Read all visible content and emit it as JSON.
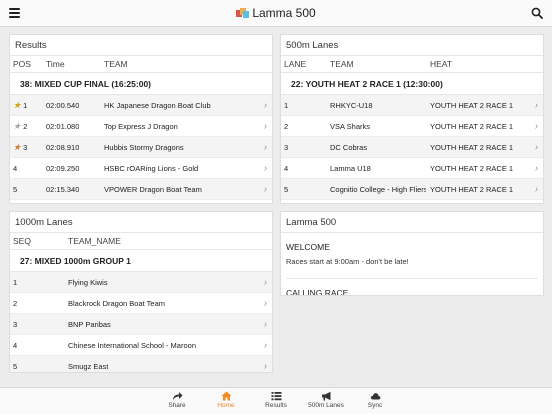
{
  "header": {
    "title": "Lamma 500"
  },
  "results": {
    "title": "Results",
    "columns": {
      "pos": "POS",
      "time": "Time",
      "team": "TEAM"
    },
    "group": "38: MIXED CUP FINAL (16:25:00)",
    "rows": [
      {
        "pos": "1",
        "time": "02:00.540",
        "team": "HK Japanese Dragon Boat Club",
        "medal": "gold"
      },
      {
        "pos": "2",
        "time": "02:01.080",
        "team": "Top Express J Dragon",
        "medal": "silver"
      },
      {
        "pos": "3",
        "time": "02:08.910",
        "team": "Hubbis Stormy Dragons",
        "medal": "bronze"
      },
      {
        "pos": "4",
        "time": "02:09.250",
        "team": "HSBC rOARing Lions - Gold",
        "medal": ""
      },
      {
        "pos": "5",
        "time": "02:15.340",
        "team": "VPOWER Dragon Boat Team",
        "medal": ""
      }
    ]
  },
  "lanes500": {
    "title": "500m Lanes",
    "columns": {
      "lane": "LANE",
      "team": "TEAM",
      "heat": "HEAT"
    },
    "group": "22: YOUTH HEAT 2 RACE 1 (12:30:00)",
    "rows": [
      {
        "lane": "1",
        "team": "RHKYC-U18",
        "heat": "YOUTH HEAT 2 RACE 1"
      },
      {
        "lane": "2",
        "team": "VSA Sharks",
        "heat": "YOUTH HEAT 2 RACE 1"
      },
      {
        "lane": "3",
        "team": "DC Cobras",
        "heat": "YOUTH HEAT 2 RACE 1"
      },
      {
        "lane": "4",
        "team": "Lamma U18",
        "heat": "YOUTH HEAT 2 RACE 1"
      },
      {
        "lane": "5",
        "team": "Cognitio College - High Fliers",
        "heat": "YOUTH HEAT 2 RACE 1"
      }
    ]
  },
  "lanes1000": {
    "title": "1000m Lanes",
    "columns": {
      "seq": "SEQ",
      "team": "TEAM_NAME"
    },
    "group": "27: MIXED 1000m GROUP 1",
    "rows": [
      {
        "seq": "1",
        "team": "Flying Kiwis"
      },
      {
        "seq": "2",
        "team": "Blackrock Dragon Boat Team"
      },
      {
        "seq": "3",
        "team": "BNP Paribas"
      },
      {
        "seq": "4",
        "team": "Chinese International School - Maroon"
      },
      {
        "seq": "5",
        "team": "Smugz East"
      }
    ]
  },
  "news": {
    "title": "Lamma 500",
    "items": [
      {
        "heading": "WELCOME",
        "body": "Races start at 9:00am - don't be late!"
      },
      {
        "heading": "CALLING RACE",
        "body": ""
      }
    ]
  },
  "tabs": [
    {
      "label": "Share",
      "icon": "share-icon"
    },
    {
      "label": "Home",
      "icon": "home-icon",
      "active": true
    },
    {
      "label": "Results",
      "icon": "list-icon"
    },
    {
      "label": "500m Lanes",
      "icon": "megaphone-icon"
    },
    {
      "label": "Sync",
      "icon": "cloud-icon"
    }
  ],
  "colors": {
    "accent": "#f08a24",
    "gold": "#d4a017",
    "silver": "#a9a9a9",
    "bronze": "#cd7f32"
  }
}
